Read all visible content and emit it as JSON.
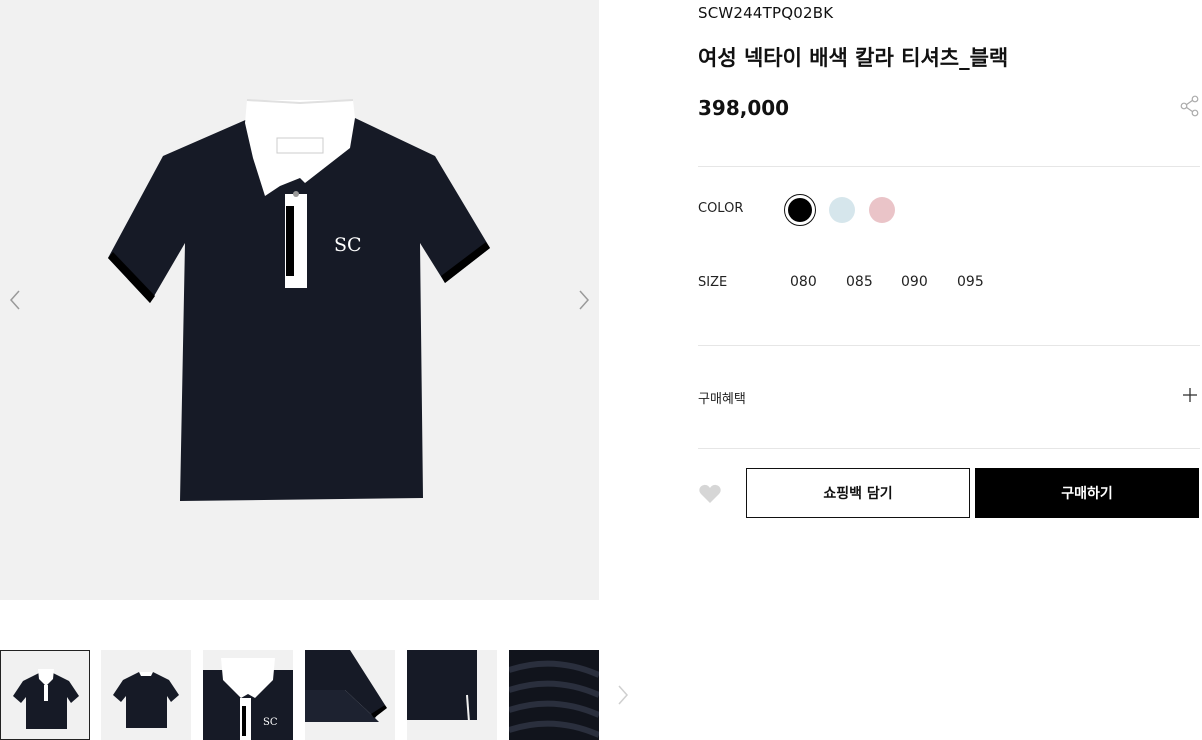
{
  "product": {
    "code": "SCW244TPQ02BK",
    "name": "여성 넥타이 배색 칼라 티셔츠_블랙",
    "price": "398,000"
  },
  "main_image": {
    "logo_text": "SC"
  },
  "options": {
    "color_label": "COLOR",
    "colors": [
      {
        "name": "black",
        "hex": "#000000",
        "selected": true
      },
      {
        "name": "light-blue",
        "hex": "#d6e6ec",
        "selected": false
      },
      {
        "name": "pink",
        "hex": "#eac4c8",
        "selected": false
      }
    ],
    "size_label": "SIZE",
    "sizes": [
      "080",
      "085",
      "090",
      "095"
    ]
  },
  "benefit": {
    "label": "구매혜택"
  },
  "actions": {
    "bag_label": "쇼핑백 담기",
    "buy_label": "구매하기"
  },
  "icons": {
    "prev": "chevron-left-icon",
    "next": "chevron-right-icon",
    "share": "share-icon",
    "expand": "plus-icon",
    "wishlist": "heart-icon"
  },
  "colors": {
    "accent": "#000000",
    "image_bg": "#f1f1f1",
    "divider": "#e6e6e6"
  }
}
